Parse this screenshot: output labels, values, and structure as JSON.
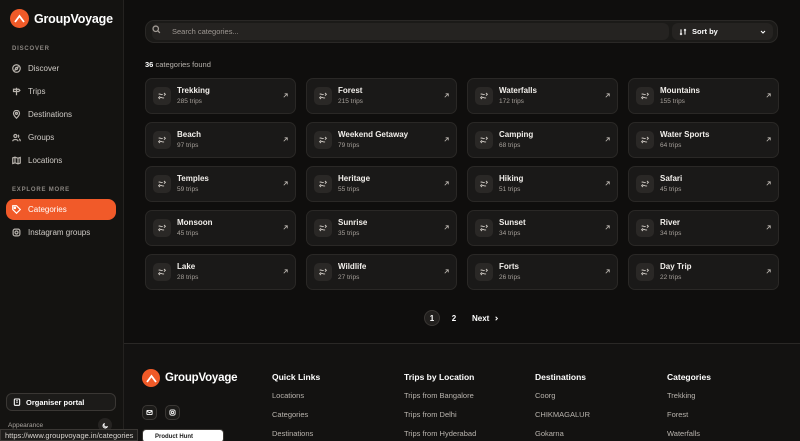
{
  "brand": {
    "name": "GroupVoyage"
  },
  "sidebar": {
    "discover_label": "DISCOVER",
    "explore_label": "EXPLORE MORE",
    "discover_items": [
      {
        "label": "Discover",
        "icon": "compass-icon"
      },
      {
        "label": "Trips",
        "icon": "signpost-icon"
      },
      {
        "label": "Destinations",
        "icon": "map-pin-icon"
      },
      {
        "label": "Groups",
        "icon": "users-icon"
      },
      {
        "label": "Locations",
        "icon": "map-icon"
      }
    ],
    "explore_items": [
      {
        "label": "Categories",
        "icon": "tag-icon",
        "active": true
      },
      {
        "label": "Instagram groups",
        "icon": "instagram-icon"
      }
    ],
    "portal_label": "Organiser portal",
    "appearance_label": "Appearance"
  },
  "search": {
    "placeholder": "Search categories..."
  },
  "sort": {
    "label": "Sort by"
  },
  "results": {
    "count": "36",
    "suffix": "categories found"
  },
  "categories": [
    {
      "name": "Trekking",
      "trips": "285 trips"
    },
    {
      "name": "Forest",
      "trips": "215 trips"
    },
    {
      "name": "Waterfalls",
      "trips": "172 trips"
    },
    {
      "name": "Mountains",
      "trips": "155 trips"
    },
    {
      "name": "Beach",
      "trips": "97 trips"
    },
    {
      "name": "Weekend Getaway",
      "trips": "79 trips"
    },
    {
      "name": "Camping",
      "trips": "68 trips"
    },
    {
      "name": "Water Sports",
      "trips": "64 trips"
    },
    {
      "name": "Temples",
      "trips": "59 trips"
    },
    {
      "name": "Heritage",
      "trips": "55 trips"
    },
    {
      "name": "Hiking",
      "trips": "51 trips"
    },
    {
      "name": "Safari",
      "trips": "45 trips"
    },
    {
      "name": "Monsoon",
      "trips": "45 trips"
    },
    {
      "name": "Sunrise",
      "trips": "35 trips"
    },
    {
      "name": "Sunset",
      "trips": "34 trips"
    },
    {
      "name": "River",
      "trips": "34 trips"
    },
    {
      "name": "Lake",
      "trips": "28 trips"
    },
    {
      "name": "Wildlife",
      "trips": "27 trips"
    },
    {
      "name": "Forts",
      "trips": "26 trips"
    },
    {
      "name": "Day Trip",
      "trips": "22 trips"
    }
  ],
  "pagination": {
    "pages": [
      "1",
      "2"
    ],
    "current": "1",
    "next_label": "Next"
  },
  "footer": {
    "brand": "GroupVoyage",
    "columns": [
      {
        "title": "Quick Links",
        "links": [
          "Locations",
          "Categories",
          "Destinations"
        ]
      },
      {
        "title": "Trips by Location",
        "links": [
          "Trips from Bangalore",
          "Trips from Delhi",
          "Trips from Hyderabad"
        ]
      },
      {
        "title": "Destinations",
        "links": [
          "Coorg",
          "CHIKMAGALUR",
          "Gokarna"
        ]
      },
      {
        "title": "Categories",
        "links": [
          "Trekking",
          "Forest",
          "Waterfalls"
        ]
      }
    ],
    "product_hunt": "Product Hunt"
  },
  "status_bar": {
    "url": "https://www.groupvoyage.in/categories"
  },
  "colors": {
    "accent": "#f15a29",
    "background": "#0f0e0d",
    "card": "#1a1918"
  }
}
